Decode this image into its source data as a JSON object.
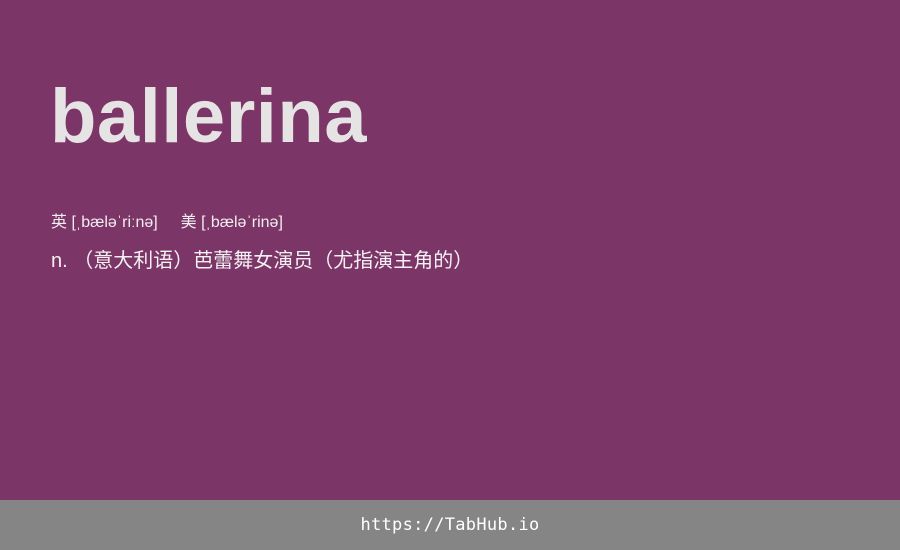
{
  "card": {
    "word": "ballerina",
    "phonetics": {
      "uk_label": "英",
      "uk_ipa": "[ˌbæləˈriːnə]",
      "us_label": "美",
      "us_ipa": "[ˌbæləˈrinə]"
    },
    "definition": "n. （意大利语）芭蕾舞女演员（尤指演主角的）",
    "background_color": "#7b3566"
  },
  "footer": {
    "link_text": "https://TabHub.io",
    "background_color": "#858585"
  }
}
